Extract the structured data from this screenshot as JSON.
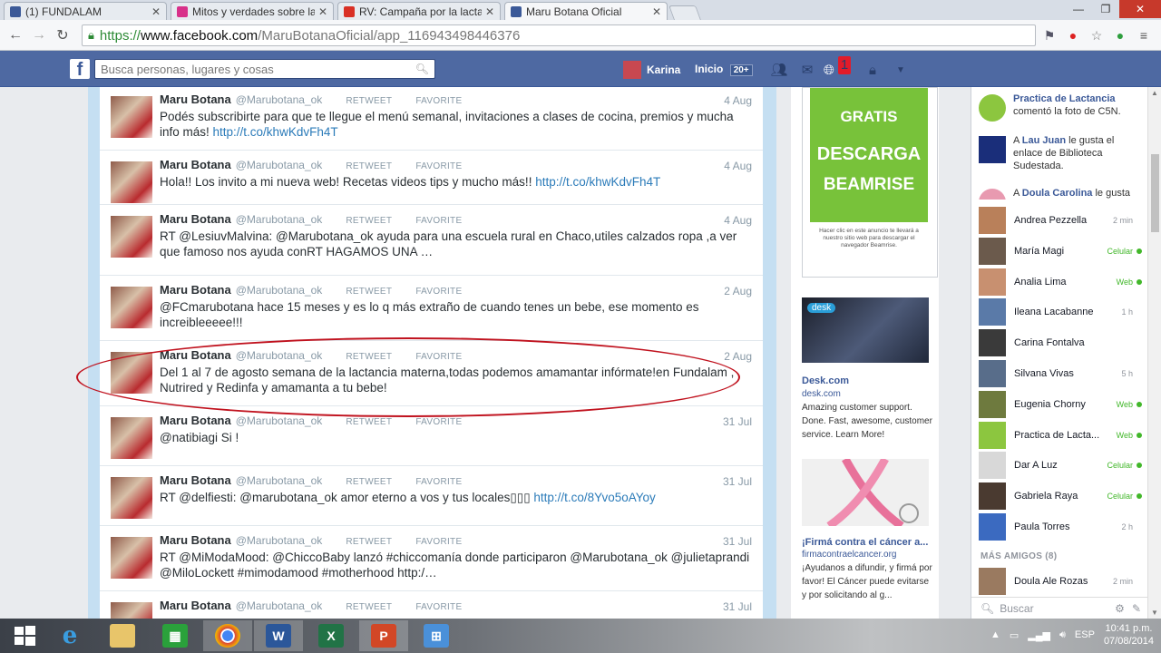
{
  "browser": {
    "tabs": [
      {
        "title": "(1) FUNDALAM",
        "icon_color": "#3b5998",
        "active": false
      },
      {
        "title": "Mitos y verdades sobre la",
        "icon_color": "#d8318a",
        "active": false
      },
      {
        "title": "RV: Campaña por la lactan",
        "icon_color": "#d93025",
        "active": false
      },
      {
        "title": "Maru Botana Oficial",
        "icon_color": "#3b5998",
        "active": true
      }
    ],
    "url_scheme": "https://",
    "url_host": "www.facebook.com",
    "url_path": "/MaruBotanaOficial/app_116943498446376"
  },
  "fb": {
    "search_placeholder": "Busca personas, lugares y cosas",
    "user_name": "Karina",
    "home_label": "Inicio",
    "home_count": "20+",
    "notif_count": "1"
  },
  "tweets": [
    {
      "name": "Maru Botana",
      "handle": "@Marubotana_ok",
      "date": "4 Aug",
      "retweet": "RETWEET",
      "favorite": "FAVORITE",
      "text": "Podés subscribirte para que te llegue el menú semanal, invitaciones a clases de cocina, premios y mucha info más! ",
      "link": "http://t.co/khwKdvFh4T"
    },
    {
      "name": "Maru Botana",
      "handle": "@Marubotana_ok",
      "date": "4 Aug",
      "retweet": "RETWEET",
      "favorite": "FAVORITE",
      "text": "Hola!! Los invito a mi nueva web! Recetas videos tips y mucho más!! ",
      "link": "http://t.co/khwKdvFh4T"
    },
    {
      "name": "Maru Botana",
      "handle": "@Marubotana_ok",
      "date": "4 Aug",
      "retweet": "RETWEET",
      "favorite": "FAVORITE",
      "text": "RT @LesiuvMalvina: @Marubotana_ok ayuda para una escuela rural en Chaco,utiles calzados ropa ,a ver que famoso nos ayuda conRT HAGAMOS UNA …",
      "link": ""
    },
    {
      "name": "Maru Botana",
      "handle": "@Marubotana_ok",
      "date": "2 Aug",
      "retweet": "RETWEET",
      "favorite": "FAVORITE",
      "text": "@FCmarubotana hace 15 meses y es lo q más extraño de cuando tenes un bebe, ese momento es increibleeeee!!!",
      "link": ""
    },
    {
      "name": "Maru Botana",
      "handle": "@Marubotana_ok",
      "date": "2 Aug",
      "retweet": "RETWEET",
      "favorite": "FAVORITE",
      "text": "Del 1 al 7 de agosto semana de la lactancia materna,todas podemos amamantar infórmate!en Fundalam , Nutrired y Redinfa y amamanta a tu bebe!",
      "link": ""
    },
    {
      "name": "Maru Botana",
      "handle": "@Marubotana_ok",
      "date": "31 Jul",
      "retweet": "RETWEET",
      "favorite": "FAVORITE",
      "text": "@natibiagi Si !",
      "link": ""
    },
    {
      "name": "Maru Botana",
      "handle": "@Marubotana_ok",
      "date": "31 Jul",
      "retweet": "RETWEET",
      "favorite": "FAVORITE",
      "text": "RT @delfiesti: @marubotana_ok amor eterno a vos y tus locales▯▯▯ ",
      "link": "http://t.co/8Yvo5oAYoy"
    },
    {
      "name": "Maru Botana",
      "handle": "@Marubotana_ok",
      "date": "31 Jul",
      "retweet": "RETWEET",
      "favorite": "FAVORITE",
      "text": "RT @MiModaMood: @ChiccoBaby lanzó #chiccomanía donde participaron @Marubotana_ok @julietaprandi @MiloLockett #mimodamood #motherhood http:/…",
      "link": ""
    },
    {
      "name": "Maru Botana",
      "handle": "@Marubotana_ok",
      "date": "31 Jul",
      "retweet": "RETWEET",
      "favorite": "FAVORITE",
      "text": "",
      "link": ""
    }
  ],
  "ads": {
    "beamrise": {
      "line1": "GRATIS",
      "line2": "DESCARGA",
      "line3": "BEAMRISE",
      "fine": "Hacer clic en este anuncio te llevará a nuestro sitio web para descargar el navegador Beamrise."
    },
    "desk": {
      "badge": "desk",
      "title": "Desk.com",
      "site": "desk.com",
      "desc": "Amazing customer support. Done. Fast, awesome, customer service. Learn More!"
    },
    "cancer": {
      "title": "¡Firmá contra el cáncer a...",
      "site": "firmacontraelcancer.org",
      "desc": "¡Ayudanos a difundir, y firmá por favor! El Cáncer puede evitarse y por solicitando al g..."
    }
  },
  "ticker": [
    {
      "actor": "Practica de Lactancia",
      "rest": "comentó la foto de C5N.",
      "color": "#8cc63f"
    },
    {
      "actor": "Lau Juan",
      "prefix": "A ",
      "rest": "le gusta el enlace de Biblioteca Sudestada.",
      "color": "#1a2e7a"
    },
    {
      "actor": "Doula Carolina",
      "prefix": "A ",
      "rest": "le gusta",
      "color": "#e89ab0"
    }
  ],
  "chat": [
    {
      "name": "Andrea Pezzella",
      "status": "2 min",
      "online": false,
      "color": "#b9805a"
    },
    {
      "name": "María Magi",
      "status": "Celular",
      "online": true,
      "color": "#6b5a4c"
    },
    {
      "name": "Analia Lima",
      "status": "Web",
      "online": true,
      "color": "#c89070"
    },
    {
      "name": "Ileana Lacabanne",
      "status": "1 h",
      "online": false,
      "color": "#5a7aa8"
    },
    {
      "name": "Carina Fontalva",
      "status": "",
      "online": false,
      "color": "#3a3a3a"
    },
    {
      "name": "Silvana Vivas",
      "status": "5 h",
      "online": false,
      "color": "#586d8a"
    },
    {
      "name": "Eugenia Chorny",
      "status": "Web",
      "online": true,
      "color": "#6e7a3e"
    },
    {
      "name": "Practica de Lacta...",
      "status": "Web",
      "online": true,
      "color": "#8cc63f"
    },
    {
      "name": "Dar A Luz",
      "status": "Celular",
      "online": true,
      "color": "#d8d8d8"
    },
    {
      "name": "Gabriela Raya",
      "status": "Celular",
      "online": true,
      "color": "#4a3a30"
    },
    {
      "name": "Paula Torres",
      "status": "2 h",
      "online": false,
      "color": "#3b6ac0"
    }
  ],
  "more_friends_label": "MÁS AMIGOS (8)",
  "more_friends": [
    {
      "name": "Doula Ale Rozas",
      "status": "2 min",
      "color": "#9a7a60"
    }
  ],
  "chat_search_placeholder": "Buscar",
  "taskbar": {
    "lang": "ESP",
    "time": "10:41 p.m.",
    "date": "07/08/2014"
  }
}
